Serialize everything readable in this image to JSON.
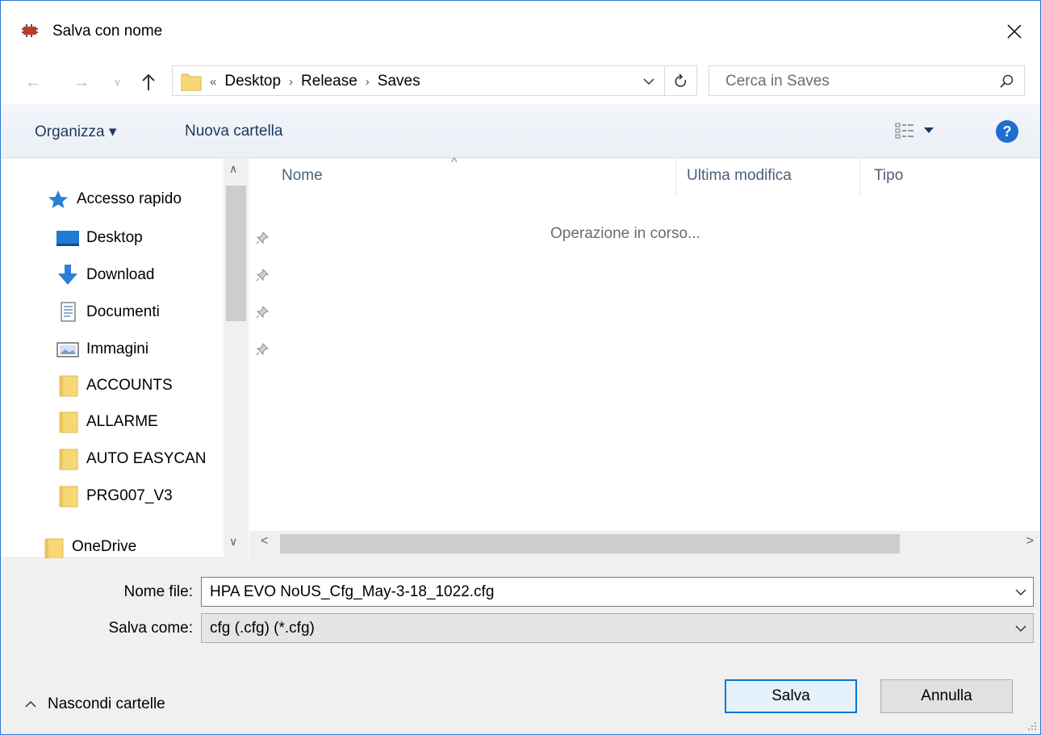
{
  "window": {
    "title": "Salva con nome",
    "close_glyph": "✕"
  },
  "address_bar": {
    "overflow": "«",
    "crumbs": [
      "Desktop",
      "Release",
      "Saves"
    ],
    "separator": "›",
    "search_placeholder": "Cerca in Saves"
  },
  "toolbar": {
    "organize_label": "Organizza ▾",
    "new_folder_label": "Nuova cartella",
    "help_label": "?"
  },
  "nav_pane": {
    "quick_access_label": "Accesso rapido",
    "items": [
      {
        "label": "Desktop",
        "icon": "desktop-icon",
        "pinned": true
      },
      {
        "label": "Download",
        "icon": "download-icon",
        "pinned": true
      },
      {
        "label": "Documenti",
        "icon": "documents-icon",
        "pinned": true
      },
      {
        "label": "Immagini",
        "icon": "pictures-icon",
        "pinned": true
      },
      {
        "label": "ACCOUNTS",
        "icon": "folder-icon",
        "pinned": false
      },
      {
        "label": "ALLARME",
        "icon": "folder-icon",
        "pinned": false
      },
      {
        "label": "AUTO EASYCAN",
        "icon": "folder-icon",
        "pinned": false
      },
      {
        "label": "PRG007_V3",
        "icon": "folder-icon",
        "pinned": false
      }
    ],
    "onedrive_label": "OneDrive"
  },
  "file_list": {
    "columns": [
      "Nome",
      "Ultima modifica",
      "Tipo"
    ],
    "status_text": "Operazione in corso..."
  },
  "form": {
    "filename_label": "Nome file:",
    "filename_value": "HPA EVO NoUS_Cfg_May-3-18_1022.cfg",
    "savetype_label": "Salva come:",
    "savetype_value": "cfg (.cfg) (*.cfg)"
  },
  "buttons": {
    "save_label": "Salva",
    "cancel_label": "Annulla",
    "hide_folders_label": "Nascondi cartelle"
  },
  "colors": {
    "accent": "#0078d7",
    "folder": "#f8d775",
    "help": "#1f6fd0"
  }
}
